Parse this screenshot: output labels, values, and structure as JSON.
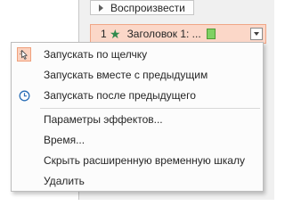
{
  "pane": {
    "play_label": "Воспроизвести",
    "play_icon": "play-icon"
  },
  "animation_item": {
    "number": "1",
    "star_icon": "★",
    "title": "Заголовок 1: ...",
    "accent_color": "#fbd7c8",
    "timebar_color": "#7fd163"
  },
  "menu": {
    "items": [
      {
        "label": "Запускать по щелчку",
        "icon": "mouse-click-icon",
        "checked": true
      },
      {
        "label": "Запускать вместе с предыдущим",
        "icon": "",
        "checked": false
      },
      {
        "label": "Запускать после предыдущего",
        "icon": "clock-icon",
        "checked": false
      },
      {
        "label": "Параметры эффектов...",
        "icon": "",
        "checked": false
      },
      {
        "label": "Время...",
        "icon": "",
        "checked": false
      },
      {
        "label": "Скрыть расширенную временную шкалу",
        "icon": "",
        "checked": false
      },
      {
        "label": "Удалить",
        "icon": "",
        "checked": false
      }
    ]
  }
}
